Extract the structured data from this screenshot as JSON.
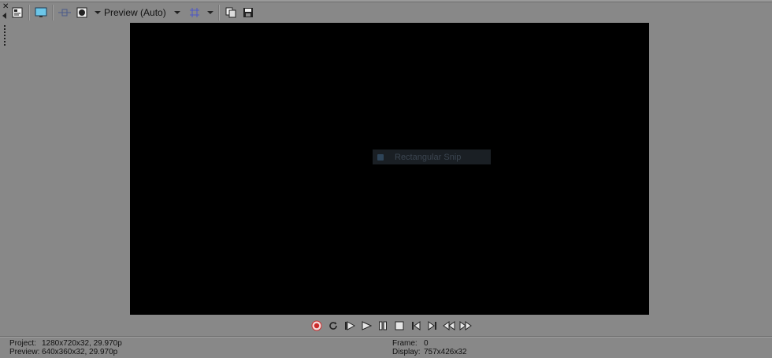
{
  "toolbar": {
    "preview_quality": "Preview (Auto)",
    "icons": [
      "video-properties-icon",
      "external-monitor-icon",
      "split-screen-icon",
      "overlay-icon",
      "grid-icon",
      "copy-snapshot-icon",
      "save-snapshot-icon"
    ]
  },
  "video": {
    "overlay_label": "Rectangular Snip"
  },
  "transport": {
    "icons": [
      "record-icon",
      "loop-icon",
      "play-from-start-icon",
      "play-icon",
      "pause-icon",
      "stop-icon",
      "previous-frame-icon",
      "next-frame-icon",
      "go-to-start-icon",
      "go-to-end-icon"
    ],
    "accent_color": "#cc2b2b"
  },
  "status": {
    "project_label": "Project:",
    "project_value": "1280x720x32, 29.970p",
    "preview_label": "Preview:",
    "preview_value": "640x360x32, 29.970p",
    "frame_label": "Frame:",
    "frame_value": "0",
    "display_label": "Display:",
    "display_value": "757x426x32"
  }
}
